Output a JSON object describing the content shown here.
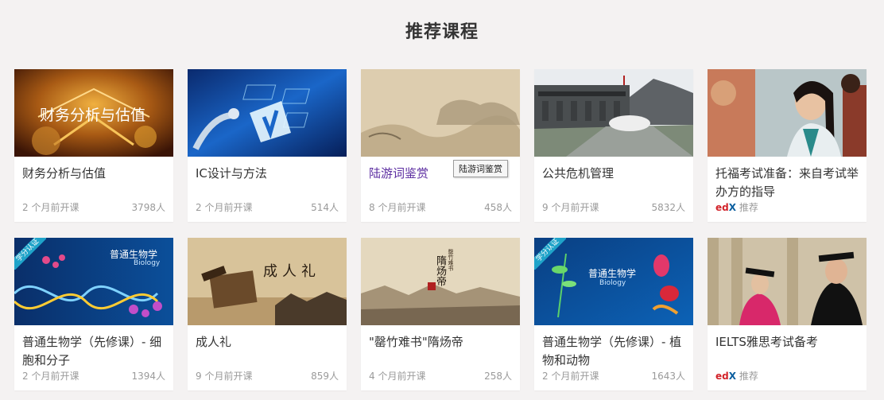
{
  "section": {
    "title": "推荐课程"
  },
  "tooltip": "陆游词鉴赏",
  "courses": [
    {
      "title": "财务分析与估值",
      "date": "2 个月前开课",
      "count": "3798人",
      "thumb_text": "财务分析与估值"
    },
    {
      "title": "IC设计与方法",
      "date": "2 个月前开课",
      "count": "514人"
    },
    {
      "title": "陆游词鉴赏",
      "date": "8 个月前开课",
      "count": "458人"
    },
    {
      "title": "公共危机管理",
      "date": "9 个月前开课",
      "count": "5832人"
    },
    {
      "title": "托福考试准备：来自考试举办方的指导",
      "partner_e": "ed",
      "partner_x": "X",
      "recommend": "推荐"
    },
    {
      "title": "普通生物学（先修课）- 细胞和分子",
      "date": "2 个月前开课",
      "count": "1394人",
      "badge": "学分认证",
      "thumb_text": "普通生物学",
      "thumb_sub": "Biology"
    },
    {
      "title": "成人礼",
      "date": "9 个月前开课",
      "count": "859人",
      "thumb_text": "成人礼"
    },
    {
      "title": "\"罄竹难书\"隋炀帝",
      "date": "4 个月前开课",
      "count": "258人",
      "thumb_text": "隋炀帝",
      "thumb_sub": "罄竹难书"
    },
    {
      "title": "普通生物学（先修课）- 植物和动物",
      "date": "2 个月前开课",
      "count": "1643人",
      "badge": "学分认证",
      "thumb_text": "普通生物学",
      "thumb_sub": "Biology"
    },
    {
      "title": "IELTS雅思考试备考",
      "partner_e": "ed",
      "partner_x": "X",
      "recommend": "推荐"
    }
  ]
}
